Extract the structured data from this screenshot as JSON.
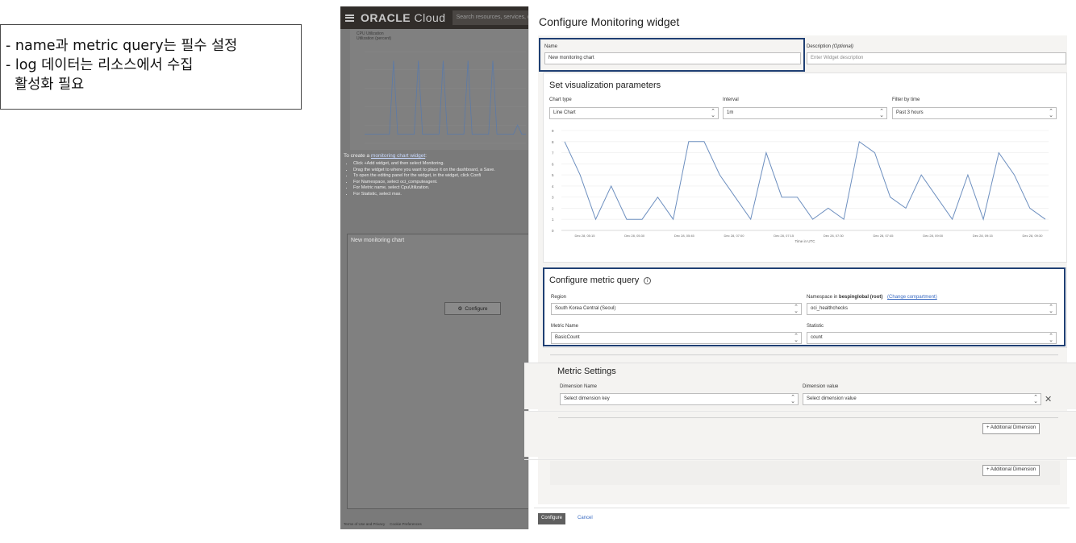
{
  "annotation": {
    "lines": [
      "- name과 metric query는 필수 설정",
      "- log 데이터는 리소스에서 수집",
      "  활성화 필요"
    ]
  },
  "console": {
    "brand": "ORACLE",
    "brand_sub": "Cloud",
    "search_placeholder": "Search resources, services, documentation",
    "mini_chart_title": "CPU Utilization",
    "mini_chart_sub": "Utilization (percent)",
    "help_lead_prefix": "To create a ",
    "help_link": "monitoring chart widget",
    "help_lead_suffix": ":",
    "help_items": [
      "Click +Add widget, and then select Monitoring.",
      "Drag the widget to where you want to place it on the dashboard, a Save.",
      "To open the editing panel for the widget, in the widget, click Confi",
      "For Namespace, select oci_computeagent.",
      "For Metric name, select CpuUtilization.",
      "For Statistic, select max."
    ],
    "widget_title": "New monitoring chart",
    "configure_button": "Configure",
    "footer_terms": "Terms of Use and Privacy",
    "footer_cookies": "Cookie Preferences"
  },
  "panel": {
    "title": "Configure Monitoring widget",
    "name_label": "Name",
    "name_value": "New monitoring chart",
    "description_label": "Description ",
    "description_optional": "(Optional)",
    "description_placeholder": "Enter Widget description",
    "visualization": {
      "title": "Set visualization parameters",
      "chart_type_label": "Chart type",
      "chart_type_value": "Line Chart",
      "interval_label": "Interval",
      "interval_value": "1m",
      "filter_label": "Filter by time",
      "filter_value": "Past 3 hours",
      "x_axis_label": "Time in UTC"
    },
    "metric_query": {
      "title": "Configure metric query",
      "region_label": "Region",
      "region_value": "South Korea Central (Seoul)",
      "namespace_label_prefix": "Namespace in ",
      "namespace_compartment": "bespinglobal (root)",
      "change_compartment": "(Change compartment)",
      "namespace_value": "oci_healthchecks",
      "metric_name_label": "Metric Name",
      "metric_name_value": "BasicCount",
      "statistic_label": "Statistic",
      "statistic_value": "count"
    },
    "metric_settings": {
      "title": "Metric Settings",
      "dimension_name_label": "Dimension Name",
      "dimension_name_placeholder": "Select dimension key",
      "dimension_value_label": "Dimension value",
      "dimension_value_placeholder": "Select dimension value",
      "additional_dimension_1": "+ Additional Dimension",
      "additional_dimension_2": "+ Additional Dimension"
    },
    "configure_button": "Configure",
    "cancel_link": "Cancel"
  },
  "chart_data": {
    "type": "line",
    "title": "",
    "xlabel": "Time in UTC",
    "ylabel": "",
    "ylim": [
      0,
      9
    ],
    "y_ticks": [
      0,
      1,
      2,
      3,
      4,
      5,
      6,
      7,
      8,
      9
    ],
    "x_ticks": [
      "Dec 28, 05:15",
      "Dec 28, 05:30",
      "Dec 28, 05:45",
      "Dec 28, 07:00",
      "Dec 28, 07:15",
      "Dec 28, 07:30",
      "Dec 28, 07:45",
      "Dec 28, 09:00",
      "Dec 28, 09:15",
      "Dec 28, 09:30"
    ],
    "series": [
      {
        "color": "#6d8fbf",
        "values": [
          8,
          5,
          1,
          4,
          1,
          1,
          3,
          1,
          8,
          8,
          5,
          3,
          1,
          7,
          3,
          3,
          1,
          2,
          1,
          8,
          7,
          3,
          2,
          5,
          3,
          1,
          5,
          1,
          7,
          5,
          2,
          1
        ]
      }
    ]
  },
  "mini_chart_data": {
    "type": "line",
    "series": [
      {
        "color": "#5b7aa8",
        "values": [
          1,
          1,
          1,
          1,
          1,
          1,
          1,
          9,
          1,
          1,
          1,
          1,
          1,
          9,
          1,
          1,
          1,
          1,
          1,
          9,
          1,
          1,
          1,
          1,
          1,
          9,
          1,
          1,
          1,
          1,
          1,
          9,
          1,
          1,
          1,
          1,
          1,
          2,
          1,
          1
        ]
      }
    ]
  }
}
